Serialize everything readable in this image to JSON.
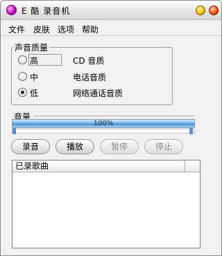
{
  "window": {
    "title": "E 酷 录音机"
  },
  "menu": {
    "items": [
      "文件",
      "皮肤",
      "选项",
      "帮助"
    ]
  },
  "quality": {
    "title": "声音质量",
    "options": [
      {
        "label": "高",
        "description": "CD 音质",
        "selected": false
      },
      {
        "label": "中",
        "description": "电话音质",
        "selected": false
      },
      {
        "label": "低",
        "description": "网络通话音质",
        "selected": true
      }
    ]
  },
  "volume": {
    "label": "音量",
    "percent_text": "100%",
    "level": 1.0
  },
  "buttons": {
    "record": "录音",
    "play": "播放",
    "pause": "暂停",
    "stop": "停止"
  },
  "recorded_list": {
    "column_header": "已录歌曲",
    "rows": []
  },
  "colors": {
    "accent": "#4e8fd0",
    "app_icon": "#c000c0"
  }
}
